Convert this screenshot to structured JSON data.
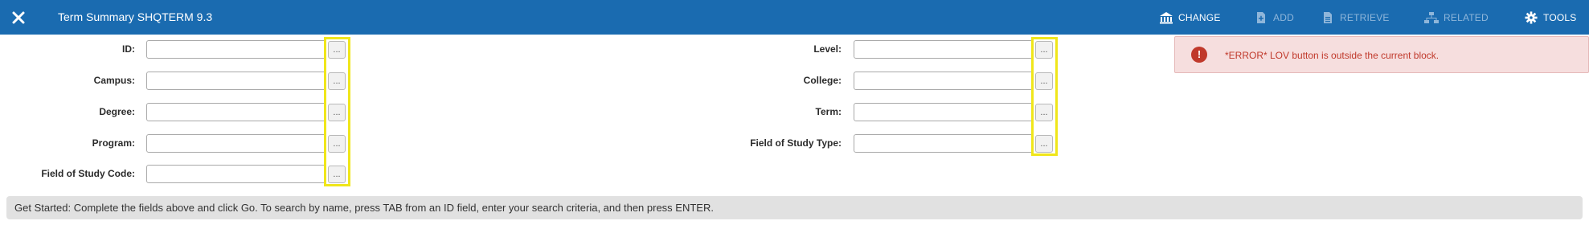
{
  "header": {
    "title": "Term Summary SHQTERM 9.3",
    "close_icon": "close-icon",
    "buttons": {
      "change": "CHANGE",
      "add": "ADD",
      "retrieve": "RETRIEVE",
      "related": "RELATED",
      "tools": "TOOLS"
    }
  },
  "form": {
    "left": [
      {
        "label": "ID:",
        "value": ""
      },
      {
        "label": "Campus:",
        "value": ""
      },
      {
        "label": "Degree:",
        "value": ""
      },
      {
        "label": "Program:",
        "value": ""
      },
      {
        "label": "Field of Study Code:",
        "value": ""
      }
    ],
    "right": [
      {
        "label": "Level:",
        "value": ""
      },
      {
        "label": "College:",
        "value": ""
      },
      {
        "label": "Term:",
        "value": ""
      },
      {
        "label": "Field of Study Type:",
        "value": ""
      }
    ],
    "lov_button": "..."
  },
  "notification": {
    "icon": "exclamation",
    "message": "*ERROR* LOV button is outside the current block."
  },
  "status_message": "Get Started: Complete the fields above and click Go. To search by name, press TAB from an ID field, enter your search criteria, and then press ENTER.",
  "colors": {
    "header_bg": "#1a6bb0",
    "highlight": "#f0e61a",
    "error_bg": "#f6dede",
    "error_text": "#c0392b"
  }
}
